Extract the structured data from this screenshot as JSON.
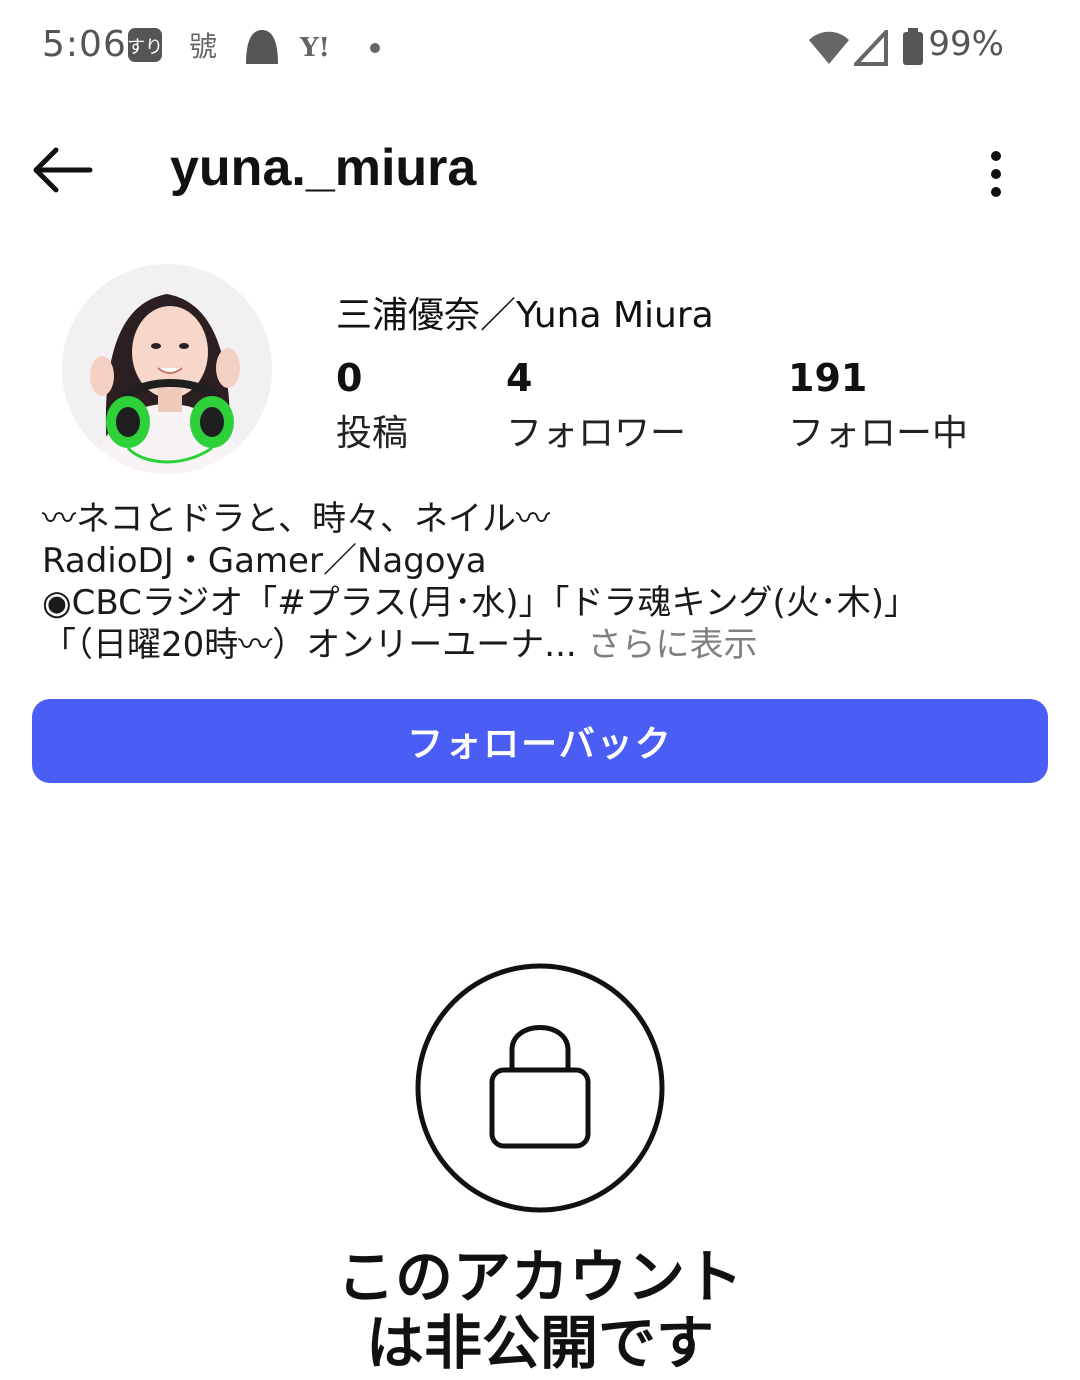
{
  "status_bar": {
    "time": "5:06",
    "battery": "99%",
    "icons": [
      "notification-app-icon",
      "kanji-app-icon",
      "ghost-icon",
      "yahoo-icon",
      "dot-icon",
      "wifi-icon",
      "signal-icon",
      "battery-icon"
    ]
  },
  "header": {
    "username": "yuna._miura",
    "back_icon": "arrow-left-icon",
    "menu_icon": "more-vertical-icon"
  },
  "profile": {
    "display_name": "三浦優奈／Yuna Miura",
    "stats": [
      {
        "count": "0",
        "label": "投稿"
      },
      {
        "count": "4",
        "label": "フォロワー"
      },
      {
        "count": "191",
        "label": "フォロー中"
      }
    ],
    "bio_lines": [
      "〰ネコとドラと、時々、ネイル〰",
      "RadioDJ・Gamer／Nagoya",
      "◉CBCラジオ「#プラス(月･水)」「ドラ魂キング(火･木)」",
      "「（日曜20時〰）オンリーユーナ..."
    ],
    "more_label": " さらに表示"
  },
  "actions": {
    "follow_back": "フォローバック"
  },
  "private": {
    "icon": "lock-icon",
    "line1": "このアカウント",
    "line2": "は非公開です"
  },
  "colors": {
    "accent": "#4a5ef5",
    "muted": "#808080",
    "avatar_headphones": "#2ed13a"
  }
}
